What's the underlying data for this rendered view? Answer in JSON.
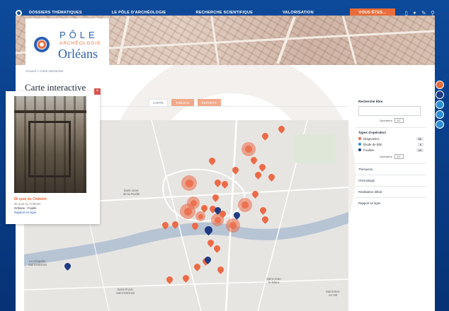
{
  "nav": {
    "items": [
      "Dossiers thématiques",
      "Le pôle d'archéologie",
      "Recherche scientifique",
      "Valorisation",
      "Vous êtes..."
    ]
  },
  "brand": {
    "line1": "PÔLE",
    "line2": "ARCHÉOLOGIE",
    "line3": "Orléans"
  },
  "breadcrumb": "Accueil  >  Carte interactive",
  "page_title": "Carte interactive",
  "tabs": [
    "CARTE",
    "TABLEAU",
    "REPORTS"
  ],
  "map_labels": {
    "saint_jean": "Saint-Jean-\nde-la-Ruelle",
    "chapelle": "La Chapelle-\nSaint-Mesmin",
    "saint_pryve": "Saint-Pryvé-\nSaint-Mesmin",
    "saint_jean_blanc": "Saint-Jean-\nle-Blanc",
    "saint_den": "Saint-Den-\nen-Val"
  },
  "popup": {
    "close": "×",
    "title": "80 quai du Châtelet",
    "address": "80 quai du Châtelet",
    "city_type": "Orléans - Fouille",
    "report": "Rapport en ligne"
  },
  "panel": {
    "search_title": "Recherche libre",
    "go_label": "Opérateur",
    "go_value": "ET",
    "type_title": "Types d'opération",
    "filters": [
      {
        "label": "Diagnostics",
        "count": "85",
        "color": "#ec6a46"
      },
      {
        "label": "Étude de bâti",
        "count": "6",
        "color": "#2b8fd6"
      },
      {
        "label": "Fouilles",
        "count": "28",
        "color": "#1e3a82"
      }
    ],
    "go_label2": "Opérateur",
    "go_value2": "ET",
    "accordions": [
      "Thésaurus",
      "Chronologie",
      "Réalisation début",
      "Rapport en ligne"
    ]
  }
}
